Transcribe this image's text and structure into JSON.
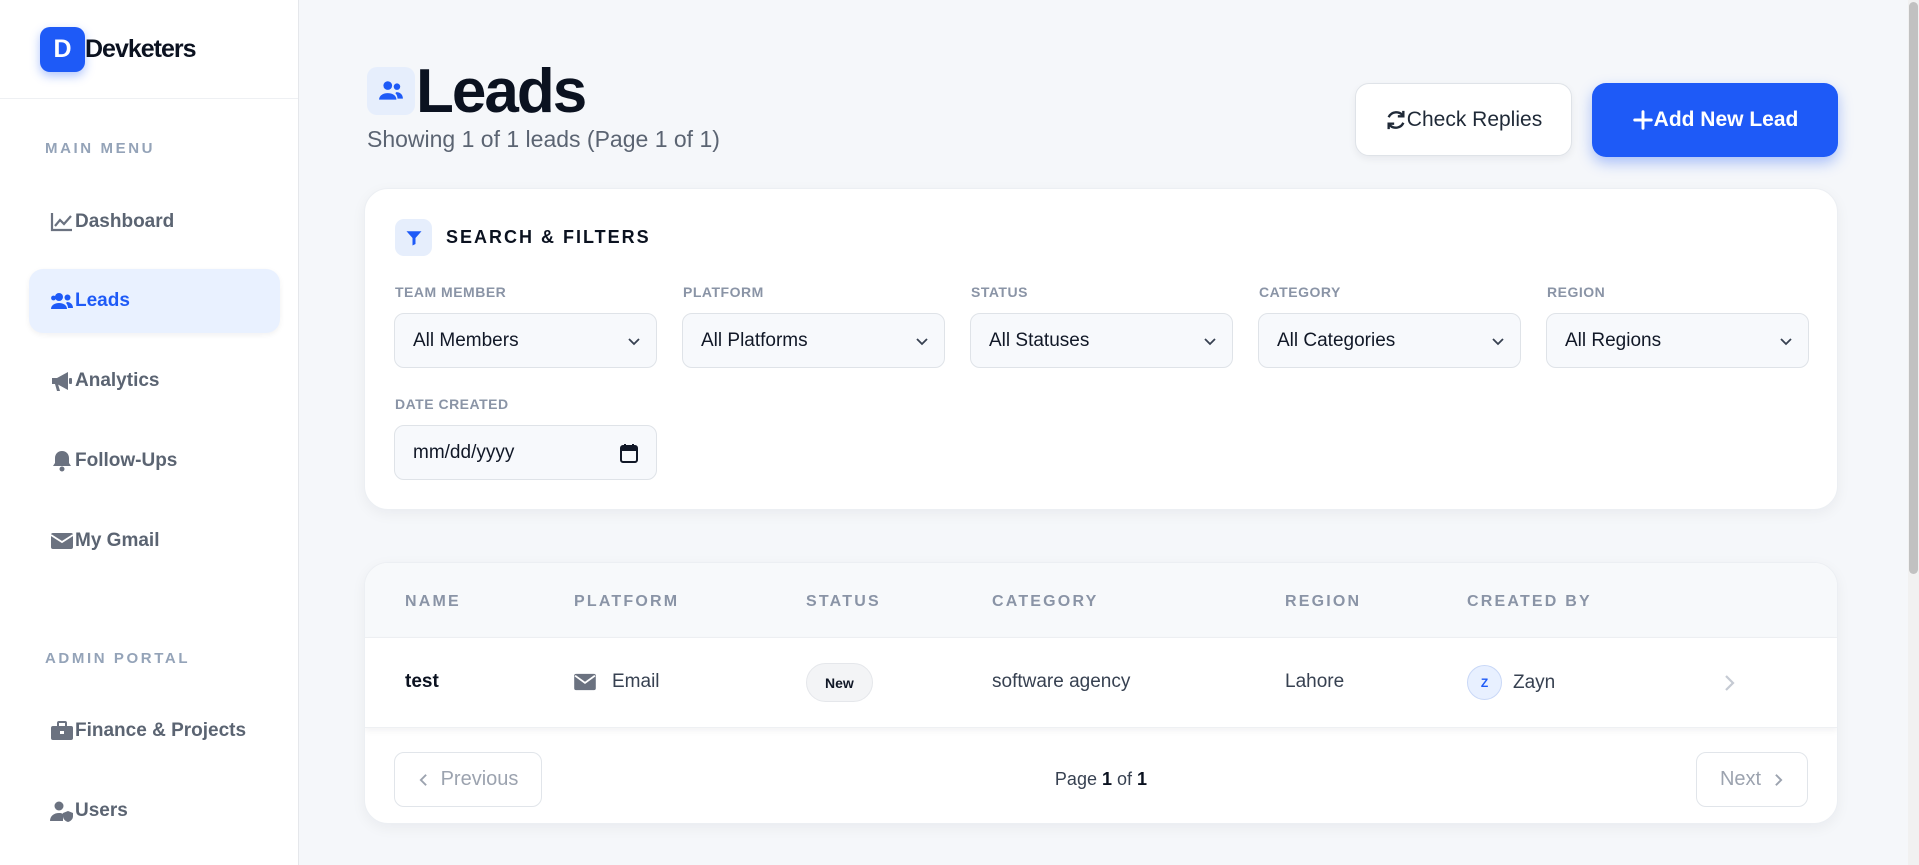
{
  "brand": {
    "logo_letter": "D",
    "name": "Devketers",
    "accent": "#1e5af7"
  },
  "sidebar": {
    "main_menu_label": "MAIN MENU",
    "admin_label": "ADMIN PORTAL",
    "main_items": [
      {
        "label": "Dashboard",
        "icon": "chart-line-icon",
        "active": false
      },
      {
        "label": "Leads",
        "icon": "users-icon",
        "active": true
      },
      {
        "label": "Analytics",
        "icon": "megaphone-icon",
        "active": false
      },
      {
        "label": "Follow-Ups",
        "icon": "bell-icon",
        "active": false
      },
      {
        "label": "My Gmail",
        "icon": "envelope-icon",
        "active": false
      }
    ],
    "admin_items": [
      {
        "label": "Finance & Projects",
        "icon": "briefcase-icon"
      },
      {
        "label": "Users",
        "icon": "user-shield-icon"
      }
    ]
  },
  "header": {
    "title": "Leads",
    "subtitle": "Showing 1 of 1 leads (Page 1 of 1)",
    "check_replies_label": "Check Replies",
    "add_lead_label": "Add New Lead"
  },
  "filters": {
    "title": "SEARCH & FILTERS",
    "team_member": {
      "label": "TEAM MEMBER",
      "value": "All Members"
    },
    "platform": {
      "label": "PLATFORM",
      "value": "All Platforms"
    },
    "status": {
      "label": "STATUS",
      "value": "All Statuses"
    },
    "category": {
      "label": "CATEGORY",
      "value": "All Categories"
    },
    "region": {
      "label": "REGION",
      "value": "All Regions"
    },
    "date_created": {
      "label": "DATE CREATED",
      "placeholder": "mm/dd/yyyy"
    }
  },
  "table": {
    "columns": [
      "NAME",
      "PLATFORM",
      "STATUS",
      "CATEGORY",
      "REGION",
      "CREATED BY"
    ],
    "rows": [
      {
        "name": "test",
        "platform": "Email",
        "status": "New",
        "category": "software agency",
        "region": "Lahore",
        "created_by": "Zayn",
        "avatar_letter": "Z"
      }
    ]
  },
  "pagination": {
    "previous_label": "Previous",
    "next_label": "Next",
    "page_word": "Page",
    "of_word": "of",
    "current": "1",
    "total": "1"
  }
}
